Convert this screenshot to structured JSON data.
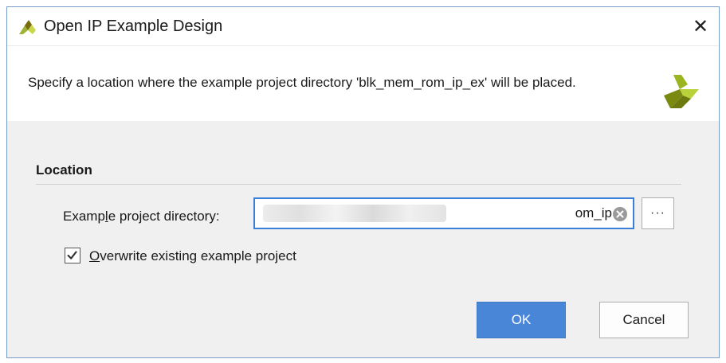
{
  "window": {
    "title": "Open IP Example Design",
    "close_glyph": "✕",
    "app_icon": "xilinx-logo-icon"
  },
  "banner": {
    "message": "Specify a location where the example project directory 'blk_mem_rom_ip_ex' will be placed.",
    "logo_icon": "xilinx-logo-icon"
  },
  "location": {
    "section_title": "Location",
    "directory_label_pre": "Examp",
    "directory_label_accel": "l",
    "directory_label_post": "e project directory:",
    "directory_value": "om_ip",
    "browse_label": "···",
    "overwrite_checked": true,
    "overwrite_label_accel": "O",
    "overwrite_label_rest": "verwrite existing example project"
  },
  "buttons": {
    "ok": "OK",
    "cancel": "Cancel"
  },
  "colors": {
    "accent": "#4a86d8",
    "input_focus": "#3c7fd9",
    "logo_green": "#8cc63f",
    "logo_dark": "#a08a1a"
  }
}
